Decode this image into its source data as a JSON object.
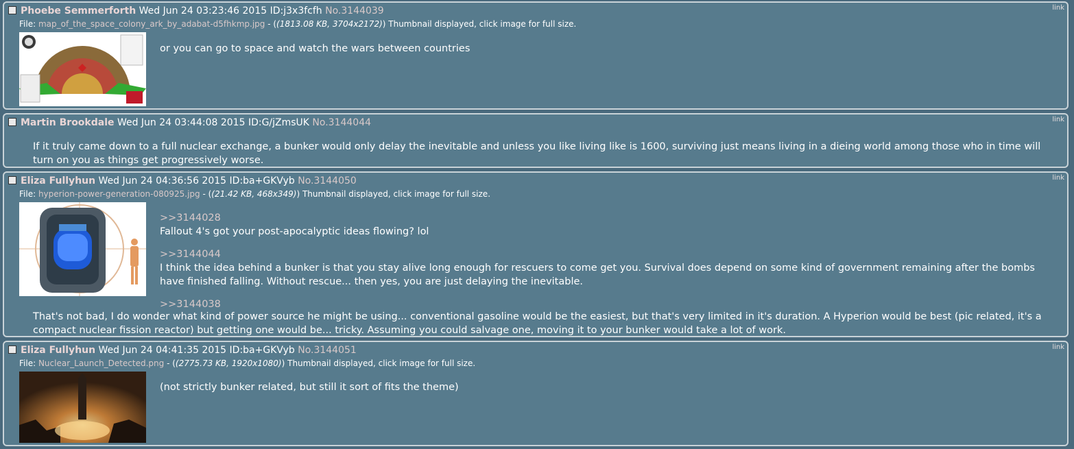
{
  "posts": [
    {
      "name": "Phoebe Semmerforth",
      "date": "Wed Jun 24 03:23:46 2015",
      "id": "ID:j3x3fcfh",
      "no": "No.3144039",
      "link": "link",
      "file_label": "File:",
      "filename": "map_of_the_space_colony_ark_by_adabat-d5fhkmp.jpg",
      "fileinfo": "(1813.08 KB, 3704x2172)",
      "thumb_note": "Thumbnail displayed, click image for full size.",
      "text": "or you can go to space and watch the wars between countries"
    },
    {
      "name": "Martin Brookdale",
      "date": "Wed Jun 24 03:44:08 2015",
      "id": "ID:G/jZmsUK",
      "no": "No.3144044",
      "link": "link",
      "text": "If it truly came down to a full nuclear exchange, a bunker would only delay the inevitable and unless you like living like is 1600, surviving just means living in a dieing world among those who in time will turn on you as things get progressively worse."
    },
    {
      "name": "Eliza Fullyhun",
      "date": "Wed Jun 24 04:36:56 2015",
      "id": "ID:ba+GKVyb",
      "no": "No.3144050",
      "link": "link",
      "file_label": "File:",
      "filename": "hyperion-power-generation-080925.jpg",
      "fileinfo": "(21.42 KB, 468x349)",
      "thumb_note": "Thumbnail displayed, click image for full size.",
      "quote1": ">>3144028",
      "text1": "Fallout 4's got your post-apocalyptic ideas flowing? lol",
      "quote2": ">>3144044",
      "text2": "I think the idea behind a bunker is that you stay alive long enough for rescuers to come get you. Survival does depend on some kind of government remaining after the bombs have finished falling. Without rescue... then yes, you are just delaying the inevitable.",
      "quote3": ">>3144038",
      "text3": "That's not bad, I do wonder what kind of power source he might be using... conventional gasoline would be the easiest, but that's very limited in it's duration. A Hyperion would be best (pic related, it's a compact nuclear fission reactor) but getting one would be... tricky. Assuming you could salvage one, moving it to your bunker would take a lot of work."
    },
    {
      "name": "Eliza Fullyhun",
      "date": "Wed Jun 24 04:41:35 2015",
      "id": "ID:ba+GKVyb",
      "no": "No.3144051",
      "link": "link",
      "file_label": "File:",
      "filename": "Nuclear_Launch_Detected.png",
      "fileinfo": "(2775.73 KB, 1920x1080)",
      "thumb_note": "Thumbnail displayed, click image for full size.",
      "text": "(not strictly bunker related, but still it sort of fits the theme)"
    }
  ]
}
